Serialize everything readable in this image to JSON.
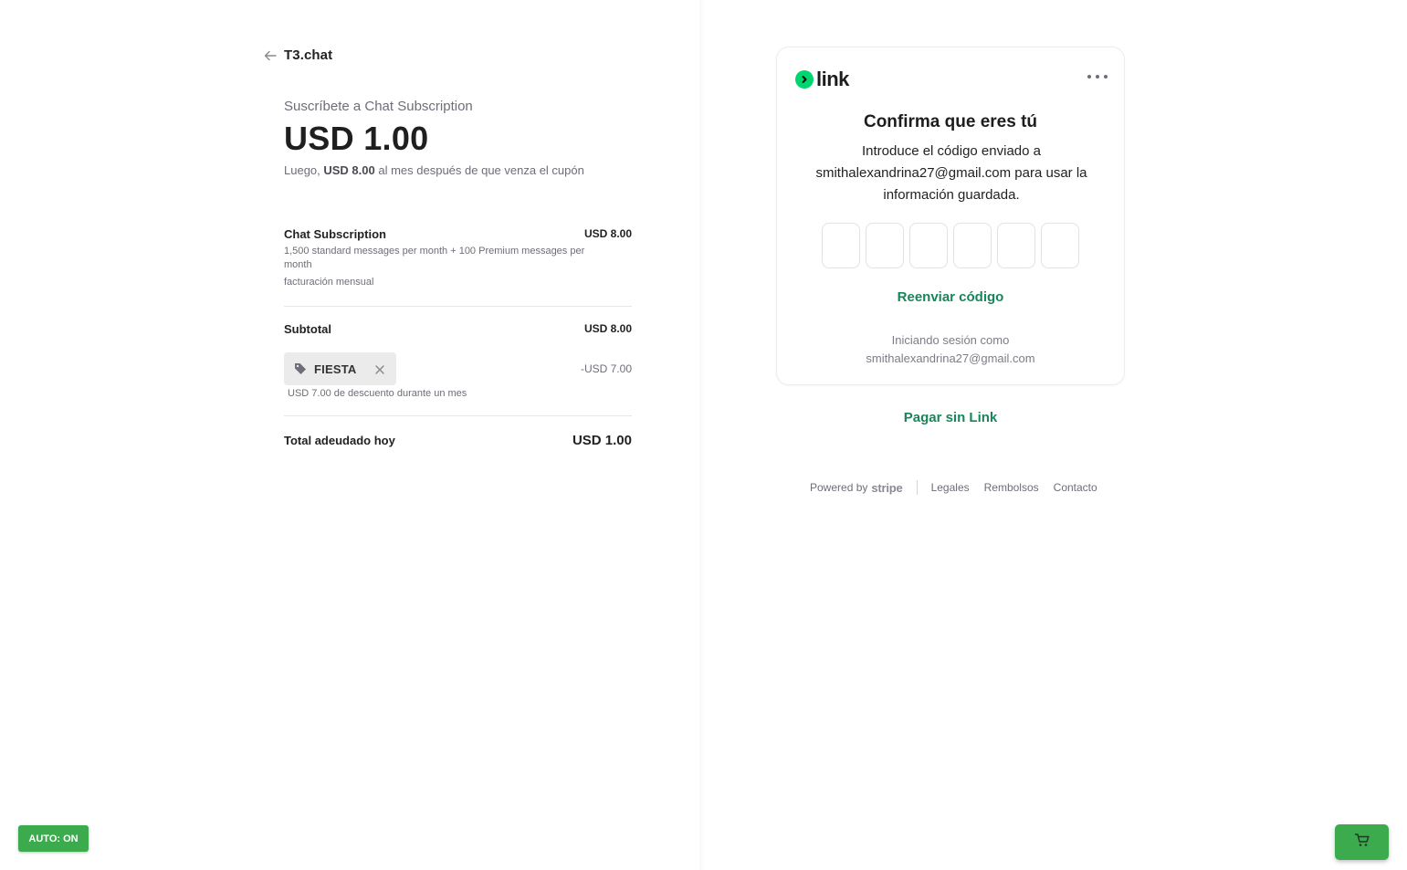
{
  "merchant": {
    "name": "T3.chat"
  },
  "summary": {
    "subscribe_label": "Suscríbete a Chat Subscription",
    "price": "USD 1.00",
    "after_prefix": "Luego, ",
    "after_amount": "USD 8.00",
    "after_suffix": " al mes después de que venza el cupón"
  },
  "line_item": {
    "name": "Chat Subscription",
    "price": "USD 8.00",
    "description": "1,500 standard messages per month + 100 Premium messages per month",
    "billing": "facturación mensual"
  },
  "subtotal": {
    "label": "Subtotal",
    "value": "USD 8.00"
  },
  "coupon": {
    "code": "FIESTA",
    "amount": "-USD 7.00",
    "note": "USD 7.00 de descuento durante un mes"
  },
  "total": {
    "label": "Total adeudado hoy",
    "value": "USD 1.00"
  },
  "link_card": {
    "logo_text": "link",
    "title": "Confirma que eres tú",
    "instructions": "Introduce el código enviado a smithalexandrina27@gmail.com para usar la información guardada.",
    "otp_length": 6,
    "resend_label": "Reenviar código",
    "signed_in_label": "Iniciando sesión como",
    "signed_in_email": "smithalexandrina27@gmail.com"
  },
  "pay_without_link": "Pagar sin Link",
  "footer": {
    "powered_by": "Powered by",
    "stripe": "stripe",
    "links": [
      "Legales",
      "Rembolsos",
      "Contacto"
    ]
  },
  "auto_badge": "AUTO: ON",
  "colors": {
    "link_green": "#00d66f",
    "action_green": "#19855a",
    "badge_green": "#3bab4e"
  },
  "icons": [
    "back-arrow-icon",
    "tag-icon",
    "close-icon",
    "more-dots-icon",
    "cart-icon"
  ]
}
